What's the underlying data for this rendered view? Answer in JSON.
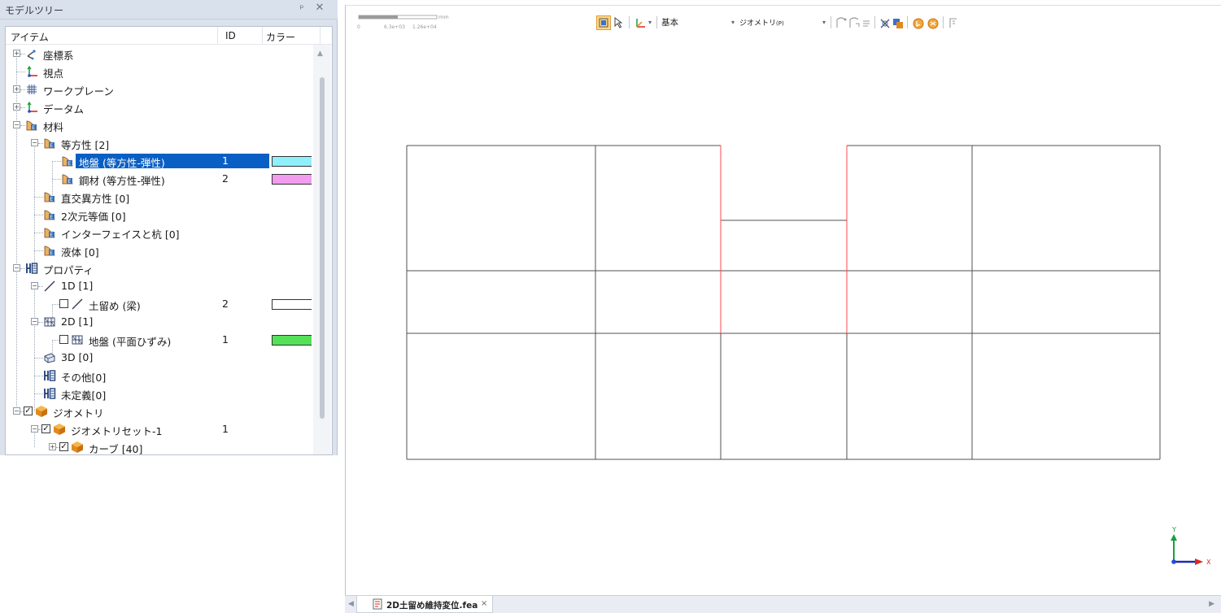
{
  "panel": {
    "title": "モデルツリー",
    "pin_icon": "pin-icon",
    "close_label": "✕",
    "pin_label": "ᵖ"
  },
  "columns": {
    "item": "アイテム",
    "id": "ID",
    "color": "カラー"
  },
  "tree": {
    "r0": "座標系",
    "r1": "視点",
    "r2": "ワークプレーン",
    "r3": "データム",
    "r4": "材料",
    "r5": "等方性 [2]",
    "r6": "地盤 (等方性-弾性)",
    "r6_id": "1",
    "r7": "鋼材 (等方性-弾性)",
    "r7_id": "2",
    "r8": "直交異方性 [0]",
    "r9": "2次元等価 [0]",
    "r10": "インターフェイスと杭 [0]",
    "r11": "液体 [0]",
    "r12": "プロパティ",
    "r13": "1D [1]",
    "r14": "土留め (梁)",
    "r14_id": "2",
    "r15": "2D [1]",
    "r16": "地盤 (平面ひずみ)",
    "r16_id": "1",
    "r17": "3D [0]",
    "r18": "その他[0]",
    "r19": "未定義[0]",
    "r20": "ジオメトリ",
    "r21": "ジオメトリセット-1",
    "r21_id": "1",
    "r22": "カーブ [40]"
  },
  "colors": {
    "ground": "#8ef0fb",
    "steel": "#f29cf0",
    "wall": "#ffffff",
    "ground_2d": "#55e05a",
    "selection": "#0a5fc4",
    "mesh_line": "#505050",
    "wall_line": "#ff4a4a"
  },
  "scale": {
    "unit": "mm",
    "t0": "0",
    "t1": "6.3e+03",
    "t2": "1.26e+04"
  },
  "toolbar": {
    "mode": "基本",
    "filter": "ジオメトリ",
    "filter_hotkey": "(P)"
  },
  "triad": {
    "x": "X",
    "y": "Y"
  },
  "document": {
    "tab_name": "2D土留め維持変位.fea",
    "close": "×"
  }
}
